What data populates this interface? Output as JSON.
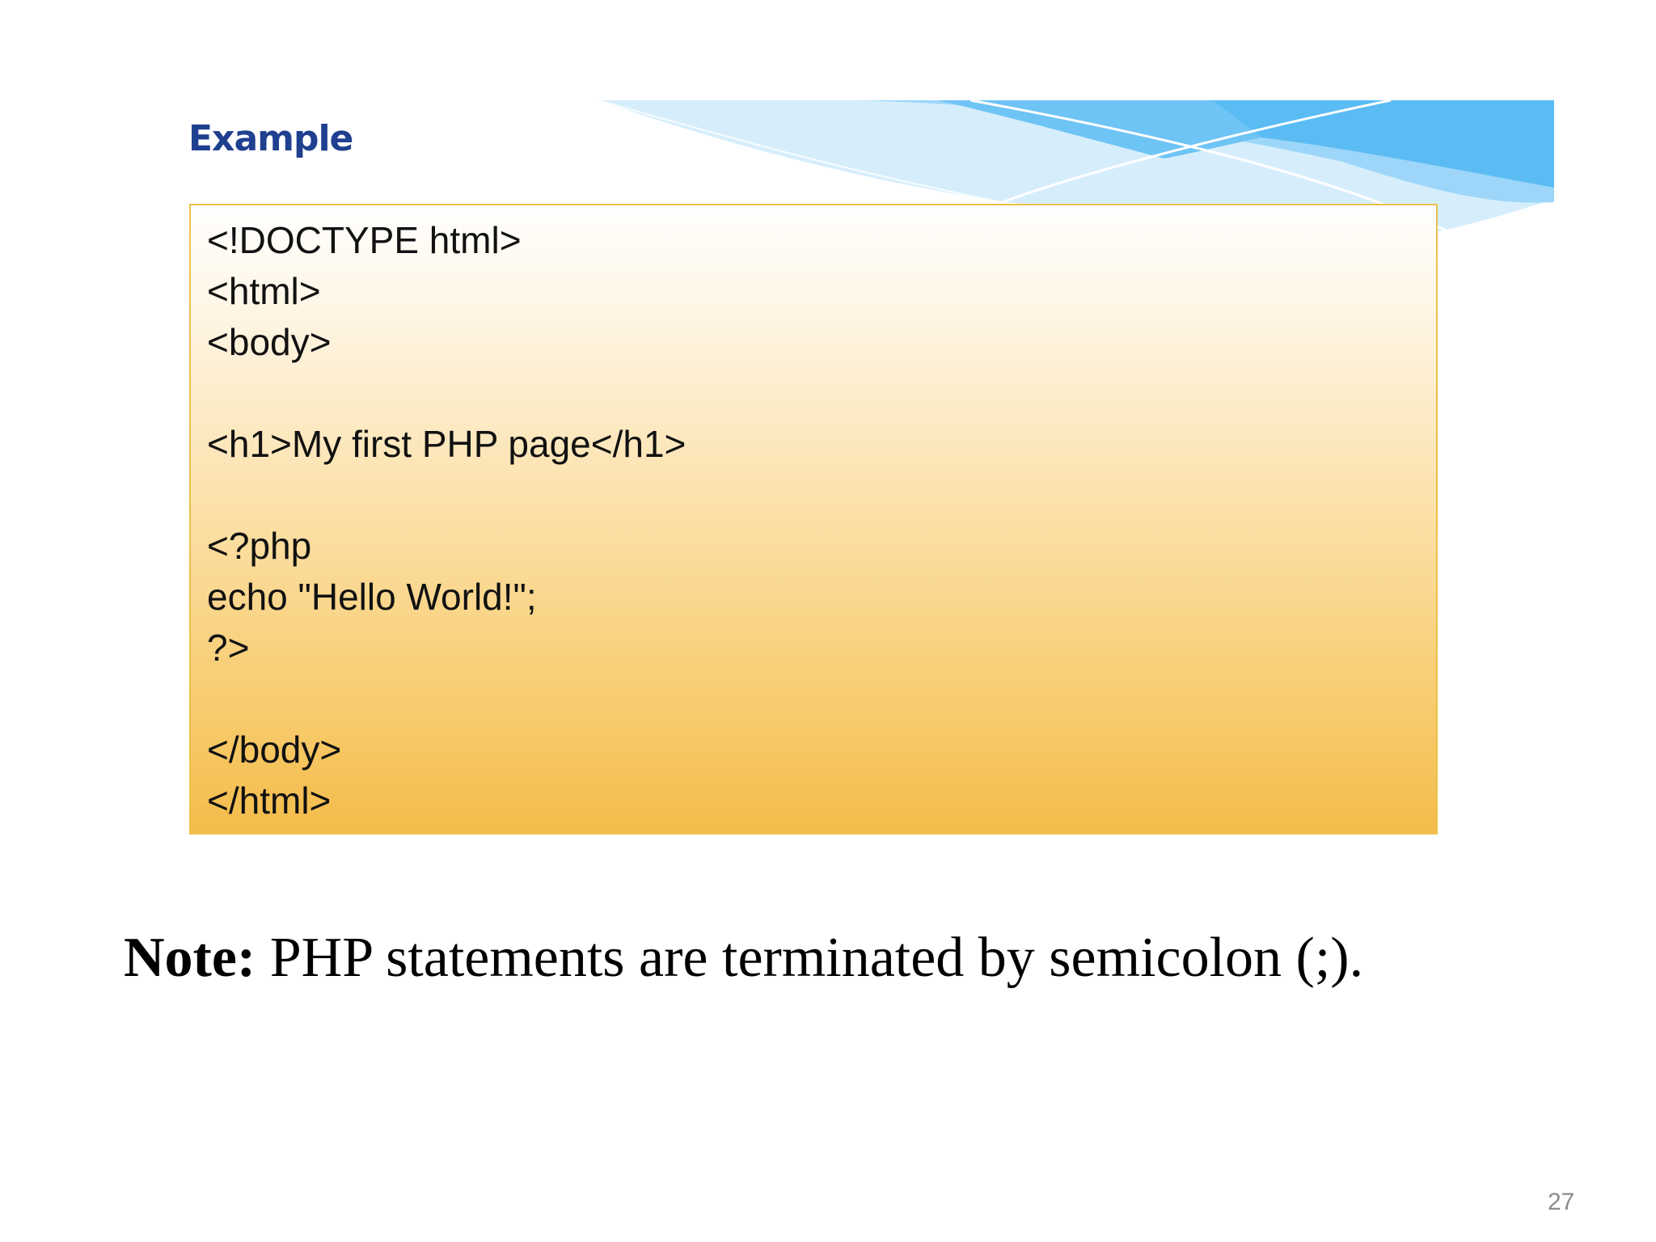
{
  "slide": {
    "example_title": "Example",
    "code_lines": [
      "<!DOCTYPE html>",
      "<html>",
      "<body>",
      "",
      "<h1>My first PHP page</h1>",
      "",
      "<?php",
      "echo \"Hello World!\";",
      "?>",
      "",
      "</body>",
      "</html>"
    ],
    "note_label": "Note:",
    "note_text": " PHP statements are terminated by semicolon (;).",
    "page_number": "27"
  },
  "colors": {
    "title": "#1f3f8f",
    "code_box_border": "#ecc04a",
    "code_box_gradient_top": "#ffffff",
    "code_box_gradient_bottom": "#f4bc4b",
    "banner_blue": "#5bbcf4",
    "page_number": "#8c8c8c"
  }
}
